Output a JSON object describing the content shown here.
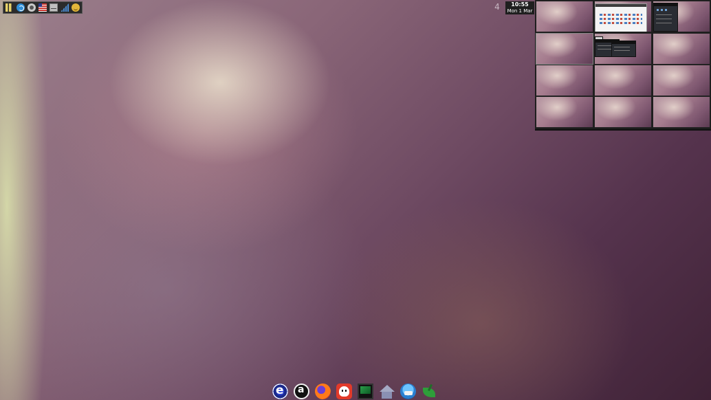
{
  "tray": {
    "icons": [
      "cpu-monitor-icon",
      "network-icon",
      "clock-app-icon",
      "keyboard-layout-flag-icon",
      "mail-icon",
      "signal-strength-icon",
      "emoticon-icon"
    ]
  },
  "workspace": {
    "current_number": "4"
  },
  "clock": {
    "time": "10:55",
    "date": "Mon  1 Mar"
  },
  "pager": {
    "columns": 3,
    "rows": 4
  },
  "dock": {
    "icons": [
      "eclipse-icon",
      "amarok-icon",
      "firefox-icon",
      "ghost-app-icon",
      "terminal-monitor-icon",
      "home-folder-icon",
      "thunderbird-icon",
      "green-app-icon"
    ]
  },
  "colors": {
    "panel_bg": "#1f1f1f",
    "tray_bg": "#2b2b2b",
    "desktop_base": "#6e4a62"
  }
}
